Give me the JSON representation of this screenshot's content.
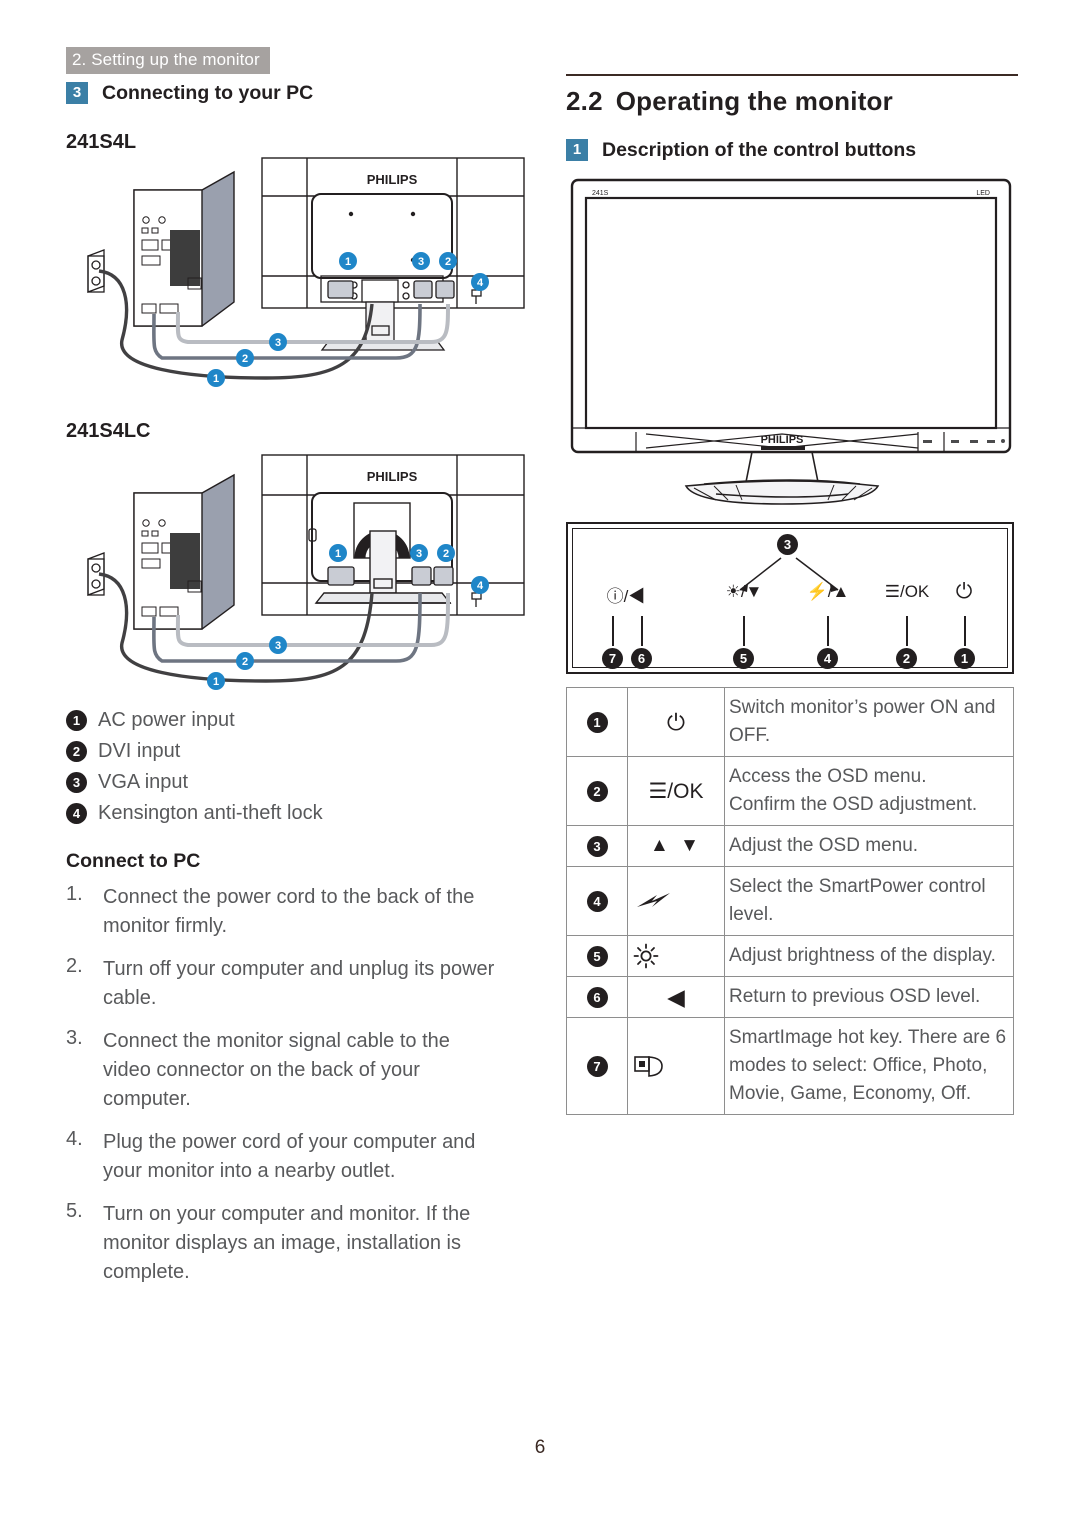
{
  "running_header": "2. Setting up the monitor",
  "left": {
    "section": {
      "number": "3",
      "title": "Connecting to your PC"
    },
    "model_1": "241S4L",
    "model_2": "241S4LC",
    "diagram_brand": "PHILIPS",
    "legend": [
      {
        "n": "1",
        "label": "AC power input"
      },
      {
        "n": "2",
        "label": "DVI input"
      },
      {
        "n": "3",
        "label": "VGA input"
      },
      {
        "n": "4",
        "label": "Kensington anti-theft lock"
      }
    ],
    "connect_heading": "Connect to PC",
    "steps": [
      {
        "n": "1.",
        "text": "Connect the power cord to the back of the monitor firmly."
      },
      {
        "n": "2.",
        "text": "Turn off your computer and unplug its power cable."
      },
      {
        "n": "3.",
        "text": "Connect the monitor signal cable to the video connector on the back of your computer."
      },
      {
        "n": "4.",
        "text": "Plug the power cord of your computer and your monitor into a nearby outlet."
      },
      {
        "n": "5.",
        "text": "Turn on your computer and monitor. If the monitor displays an image, installation is complete."
      }
    ]
  },
  "right": {
    "heading_number": "2.2",
    "heading_title": "Operating the monitor",
    "section": {
      "number": "1",
      "title": "Description of the control buttons"
    },
    "monitor": {
      "model_mark": "241S",
      "led_mark": "LED",
      "brand": "PHILIPS"
    },
    "control_diagram": {
      "top_number": "3",
      "buttons": [
        {
          "n": "7",
          "glyph": "ⓘ/◀",
          "icon": "smartimage-back-icon"
        },
        {
          "n": "6",
          "glyph": "◀",
          "icon": "left-arrow-icon"
        },
        {
          "n": "5",
          "glyph": "☀/▼",
          "icon": "brightness-down-icon"
        },
        {
          "n": "4",
          "glyph": "⚡/▲",
          "icon": "smartpower-up-icon"
        },
        {
          "n": "2",
          "glyph": "☰/OK",
          "icon": "menu-ok-icon"
        },
        {
          "n": "1",
          "glyph": "⏻",
          "icon": "power-icon"
        }
      ]
    },
    "table": [
      {
        "n": "1",
        "icon": "power-icon",
        "glyph": "⏻",
        "text": "Switch monitor’s power ON and OFF."
      },
      {
        "n": "2",
        "icon": "menu-ok-icon",
        "glyph": "☰/OK",
        "text": "Access the OSD menu.\nConfirm the OSD adjustment."
      },
      {
        "n": "3",
        "icon": "up-down-arrow-icon",
        "glyph": "▲ ▼",
        "text": "Adjust the OSD menu."
      },
      {
        "n": "4",
        "icon": "smartpower-icon",
        "glyph": "⚡",
        "text": "Select the SmartPower control level."
      },
      {
        "n": "5",
        "icon": "brightness-icon",
        "glyph": "☀",
        "text": "Adjust brightness of the display."
      },
      {
        "n": "6",
        "icon": "left-arrow-icon",
        "glyph": "◀",
        "text": "Return to previous OSD level."
      },
      {
        "n": "7",
        "icon": "smartimage-icon",
        "glyph": "ⓘ",
        "text": "SmartImage hot key. There are 6 modes to select: Office, Photo, Movie, Game, Economy, Off."
      }
    ]
  },
  "page_number": "6",
  "colors": {
    "accent_blue": "#3b7fa6",
    "header_gray": "#a6a2a0",
    "body_gray": "#58595b",
    "rule": "#3b2a24"
  }
}
